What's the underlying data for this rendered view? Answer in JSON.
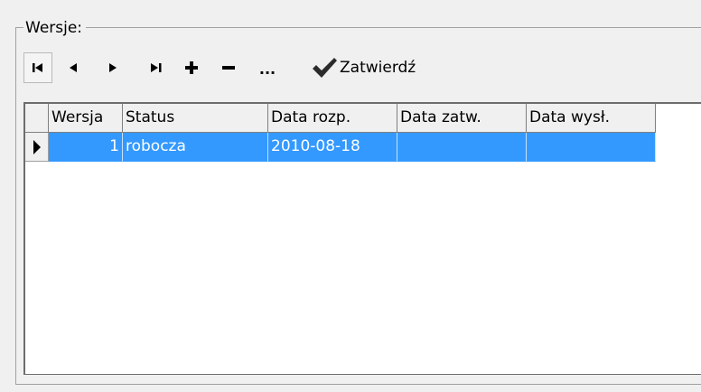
{
  "group": {
    "title": "Wersje:"
  },
  "toolbar": {
    "buttons": [
      {
        "name": "first-record",
        "icon": "skip-first-icon"
      },
      {
        "name": "prior-record",
        "icon": "triangle-left-icon"
      },
      {
        "name": "next-record",
        "icon": "triangle-right-icon"
      },
      {
        "name": "last-record",
        "icon": "skip-last-icon"
      },
      {
        "name": "insert-record",
        "icon": "plus-icon"
      },
      {
        "name": "delete-record",
        "icon": "minus-icon"
      },
      {
        "name": "edit-record",
        "icon": "ellipsis-icon"
      }
    ],
    "ellipsis_label": "...",
    "confirm_label": "Zatwierdź",
    "confirm_icon": "checkmark-icon"
  },
  "grid": {
    "columns": [
      "Wersja",
      "Status",
      "Data rozp.",
      "Data zatw.",
      "Data wysł."
    ],
    "rows": [
      {
        "wersja": "1",
        "status": "robocza",
        "data_rozp": "2010-08-18",
        "data_zatw": "",
        "data_wysl": ""
      }
    ],
    "selection_color": "#3399ff",
    "current_row_indicator": "row-pointer-icon"
  }
}
